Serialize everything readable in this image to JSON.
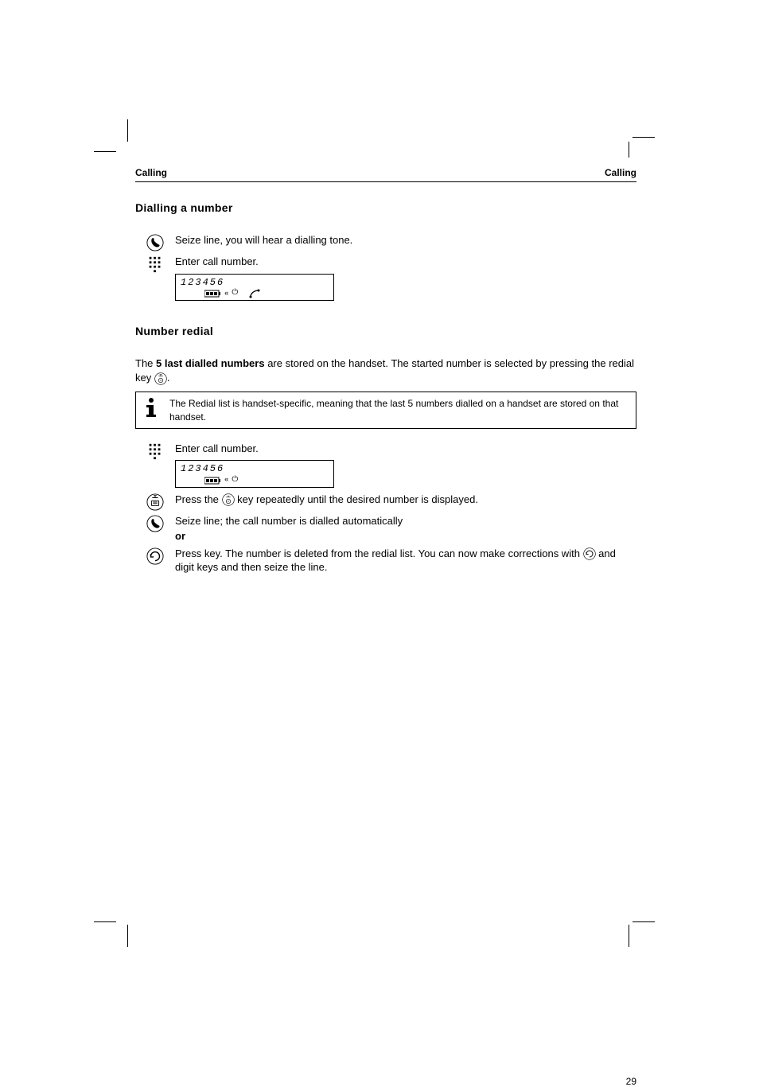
{
  "header": {
    "left": "Calling",
    "right": "Calling"
  },
  "section1": {
    "title": "Dialling a number",
    "step1": "Seize line, you will hear a dialling tone.",
    "step2": "Enter call number.",
    "display1": {
      "number": "123456"
    }
  },
  "section2": {
    "title": "Number redial",
    "intro_a": "The ",
    "intro_b": " last dialled numbers",
    "bold5": "5",
    "intro_c": " are stored on the handset. The started number is selected by pressing the redial key ",
    "intro_d": ".",
    "info": "The Redial list is handset-specific, meaning that the last 5 numbers dialled on a handset are stored on that handset.",
    "step1": "Enter call number.",
    "display1": {
      "number": "123456"
    },
    "step2_a": "Press the ",
    "step2_b": " key repeatedly until the desired number is displayed.",
    "step3": "Seize line; the call number is dialled automatically",
    "step3b": "or",
    "step4_a": "Press key. The number is deleted from the redial list. You can now make corrections with ",
    "step4_b": " and digit keys and then seize the line."
  },
  "icons": {
    "talk": "talk-key-icon",
    "keypad": "keypad-icon",
    "redial": "redial-key-icon",
    "lastnum": "last-number-key-icon",
    "info": "info-icon",
    "battery": "battery-icon",
    "power": "power-icon",
    "handset": "handset-icon"
  },
  "footer": {
    "pagenum": "29",
    "note": ""
  }
}
